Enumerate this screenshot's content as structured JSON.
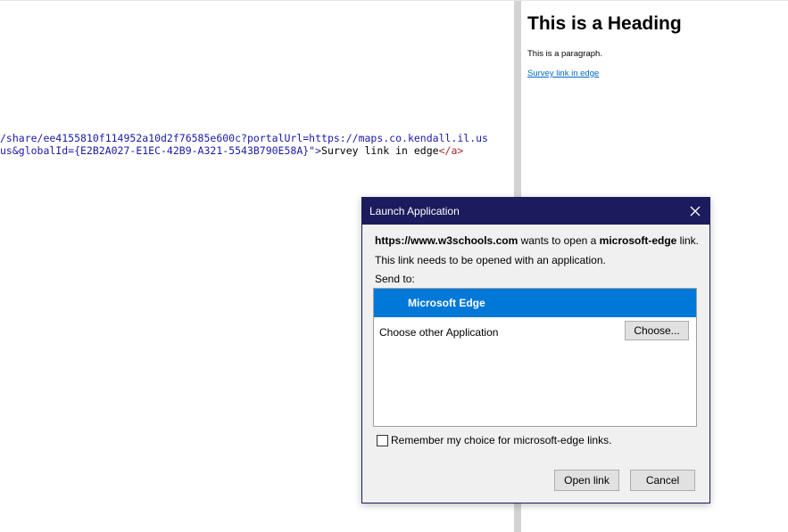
{
  "code_editor": {
    "line1": "/share/ee4155810f114952a10d2f76585e600c?portalUrl=https://maps.co.kendall.il.us",
    "line2_attr": "us&globalId={E2B2A027-E1EC-42B9-A321-5543B790E58A}\">",
    "line2_text": "Survey link in edge",
    "line2_close_tag": "</a>"
  },
  "result": {
    "heading": "This is a Heading",
    "paragraph": "This is a paragraph.",
    "link": "Survey link in edge"
  },
  "dialog": {
    "title": "Launch Application",
    "site": "https://www.w3schools.com",
    "wants_text": " wants to open a ",
    "protocol": "microsoft-edge",
    "link_suffix": " link.",
    "needs_app": "This link needs to be opened with an application.",
    "send_to": "Send to:",
    "apps": [
      {
        "label": "Microsoft Edge",
        "selected": true
      },
      {
        "label": "Choose other Application",
        "selected": false
      }
    ],
    "choose_button": "Choose...",
    "remember_label": "Remember my choice for microsoft-edge links.",
    "remember_checked": false,
    "open_button": "Open link",
    "cancel_button": "Cancel"
  },
  "colors": {
    "titlebar": "#1c1b5d",
    "selection": "#0078d7",
    "link": "#0068c7"
  },
  "icons": {
    "close": "close-icon",
    "app": "edge-icon"
  }
}
